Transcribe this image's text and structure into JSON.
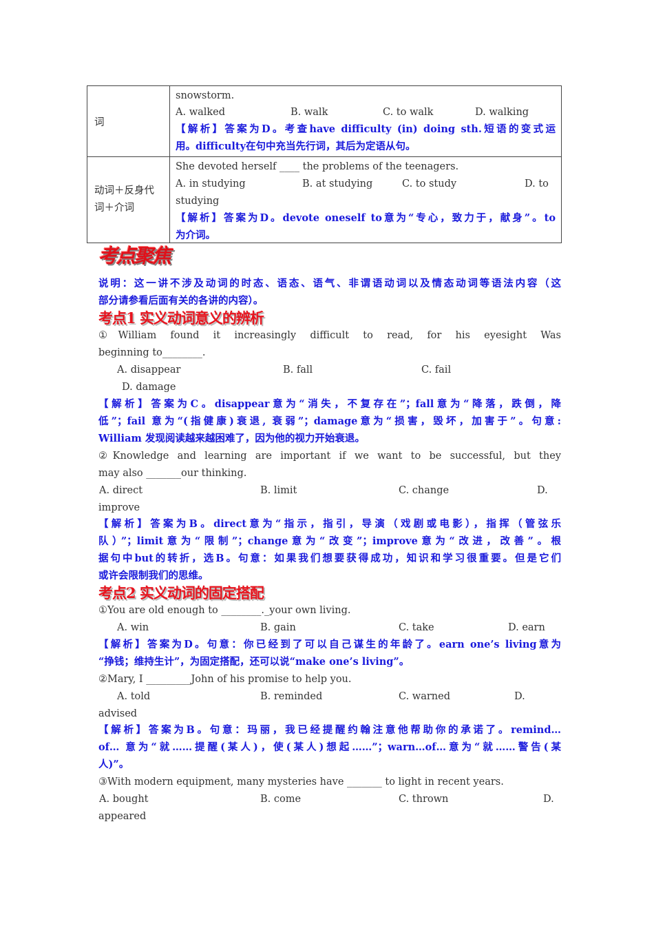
{
  "table": {
    "row1": {
      "label": "词",
      "q": "snowstorm.",
      "opts": [
        "A. walked",
        "B. walk",
        "C. to walk",
        "D. walking"
      ],
      "ana": [
        "【解析】答案为D。考查have difficulty (in) doing sth.短语的变式运",
        "用。difficulty在句中充当先行词，其后为定语从句。"
      ]
    },
    "row2": {
      "label": [
        "动词＋反身代",
        "词＋介词"
      ],
      "q": "She devoted herself ____ the problems of the teenagers.",
      "opts": [
        "A. in studying",
        "B. at studying",
        "C. to study",
        "D. to"
      ],
      "q2": "studying",
      "ana": [
        "【解析】答案为D。devote oneself to意为“专心，致力于，献身”。to",
        "为介词。"
      ]
    }
  },
  "banner": "考点聚焦",
  "note": [
    "说明：这一讲不涉及动词的时态、语态、语气、非谓语动词以及情态动词等语法内容（这",
    "部分请参看后面有关的各讲的内容）。"
  ],
  "section1": {
    "heading": "考点1 实义动词意义的辨析",
    "q1": {
      "text": [
        "①William found it increasingly difficult to read, for his eyesight Was",
        "beginning to________."
      ],
      "opts": [
        "A. disappear",
        "B. fall",
        "C. fail",
        "D. damage"
      ],
      "ana": [
        "【解析】答案为C。disappear意为“消失，不复存在”；fall意为“降落，跌倒，降",
        "低”；fail 意为“(指健康)衰退, 衰弱”；damage意为“损害，毁坏，加害于”。句意:",
        "William 发现阅读越来越困难了，因为他的视力开始衰退。"
      ]
    },
    "q2": {
      "text": [
        "②Knowledge and learning are important if we want to be successful, but they",
        "may also _______our thinking."
      ],
      "opts": [
        "A. direct",
        "B. limit",
        "C. change",
        "D."
      ],
      "opt_wrap": "improve",
      "ana": [
        "【解析】答案为B。direct意为“指示，指引，导演（戏剧或电影），指挥（管弦乐",
        "队）”；limit意为“限制”；change意为“改变”；improve意为“改进，改善”。根",
        "据句中but的转折，选B。句意：如果我们想要获得成功，知识和学习很重要。但是它们",
        "或许会限制我们的思维。"
      ]
    }
  },
  "section2": {
    "heading": "考点2 实义动词的固定搭配",
    "q1": {
      "text": "①You are old enough to ________._your own living.",
      "opts": [
        "A. win",
        "B. gain",
        "C. take",
        "D. earn"
      ],
      "ana": [
        "【解析】答案为D。句意：你已经到了可以自己谋生的年龄了。earn one’s living意为",
        "“挣钱；维持生计”，为固定搭配，还可以说“make one’s living”。"
      ]
    },
    "q2": {
      "text": "②Mary, I _________John of his promise to help you.",
      "opts": [
        "A. told",
        "B. reminded",
        "C. warned",
        "D."
      ],
      "opt_wrap": "advised",
      "ana": [
        "【解析】答案为B。句意：玛丽，我已经提醒约翰注意他帮助你的承诺了。remind…",
        "of…  意为“就……提醒(某人)，使(某人)想起……”；warn…of…意为“就……警告(某",
        "人)”。"
      ]
    },
    "q3": {
      "text": "③With modern equipment, many mysteries have _______ to light in recent years.",
      "opts": [
        "A. bought",
        "B. come",
        "C. thrown",
        "D."
      ],
      "opt_wrap": "appeared"
    }
  }
}
